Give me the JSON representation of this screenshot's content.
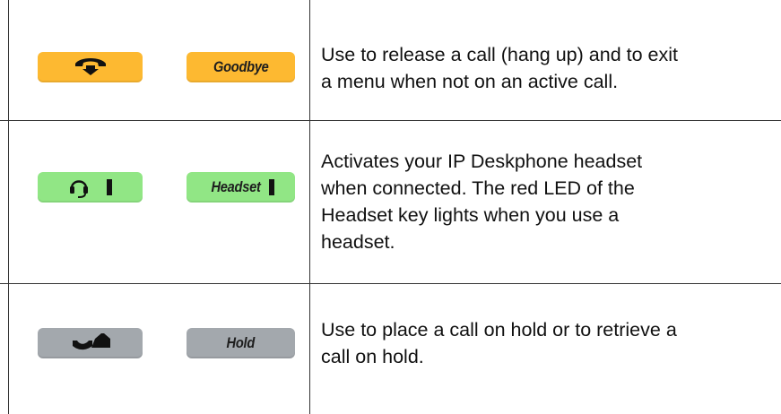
{
  "rows": [
    {
      "name": "goodbye",
      "key_color": "#fdb931",
      "icon": "hang-up-handset-icon",
      "label": "Goodbye",
      "description_lines": [
        "Use to release a call (hang up) and to exit",
        "a menu when not on an active call."
      ]
    },
    {
      "name": "headset",
      "key_color": "#91e685",
      "icon": "headset-icon",
      "label": "Headset",
      "description_lines": [
        "Activates your IP Deskphone headset",
        "when connected. The red LED of the",
        "Headset key lights when you use a",
        "headset."
      ]
    },
    {
      "name": "hold",
      "key_color": "#a3a8ad",
      "icon": "hold-handset-icon",
      "label": "Hold",
      "description_lines": [
        "Use to place a call on hold or to retrieve a",
        "call on hold."
      ]
    }
  ]
}
